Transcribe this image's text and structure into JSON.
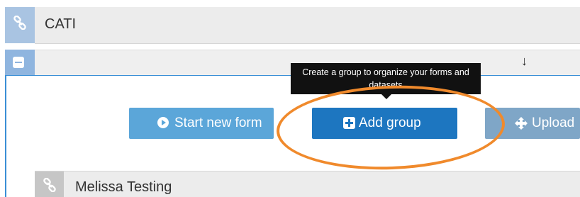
{
  "groups": {
    "top": {
      "title": "CATI"
    },
    "second": {
      "title": "Melissa Testing"
    }
  },
  "toolbar": {
    "start_label": "Start new form",
    "add_group_label": "Add group",
    "upload_label": "Upload"
  },
  "tooltip": {
    "text": "Create a group to organize your forms and datasets"
  },
  "sort_indicator": "↓",
  "icons": {
    "group_icon": "link-icon",
    "collapse_icon": "minus-square-icon",
    "start_icon": "play-circle-icon",
    "add_icon": "plus-square-icon",
    "upload_icon": "move-arrows-icon"
  },
  "colors": {
    "annotation": "#f08a2c",
    "primary": "#1d76c0",
    "secondary": "#5ba6d9",
    "tooltip_bg": "#111111"
  }
}
